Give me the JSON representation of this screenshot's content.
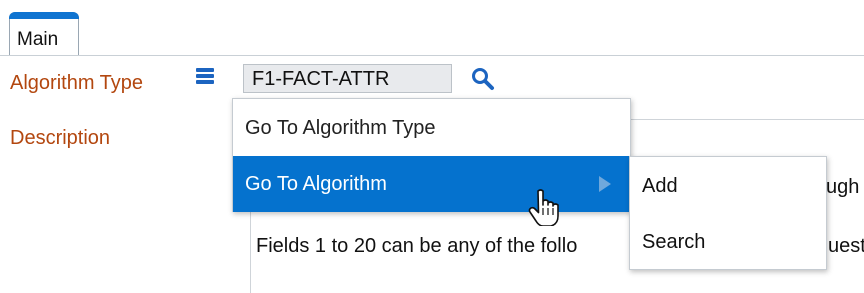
{
  "tabs": [
    {
      "label": "Main",
      "active": true
    }
  ],
  "form": {
    "algorithm_type_label": "Algorithm Type",
    "algorithm_type_value": "F1-FACT-ATTR",
    "description_label": "Description"
  },
  "description_lines": {
    "line1_tail": "ugh",
    "line2_head": "Fields 1 to 20 can be any of the follo",
    "line2_tail": "uest"
  },
  "context_menu": {
    "items": [
      {
        "label": "Go To Algorithm Type"
      },
      {
        "label": "Go To Algorithm",
        "highlighted": true,
        "has_submenu": true
      }
    ]
  },
  "submenu": {
    "items": [
      {
        "label": "Add"
      },
      {
        "label": "Search"
      }
    ]
  },
  "colors": {
    "accent": "#0f74d1",
    "label": "#b3470f",
    "highlight": "#0572ce"
  },
  "icons": {
    "menu": "hamburger-menu-icon",
    "search": "search-icon",
    "submenu_arrow": "triangle-right-icon",
    "cursor": "hand-pointer-icon"
  }
}
